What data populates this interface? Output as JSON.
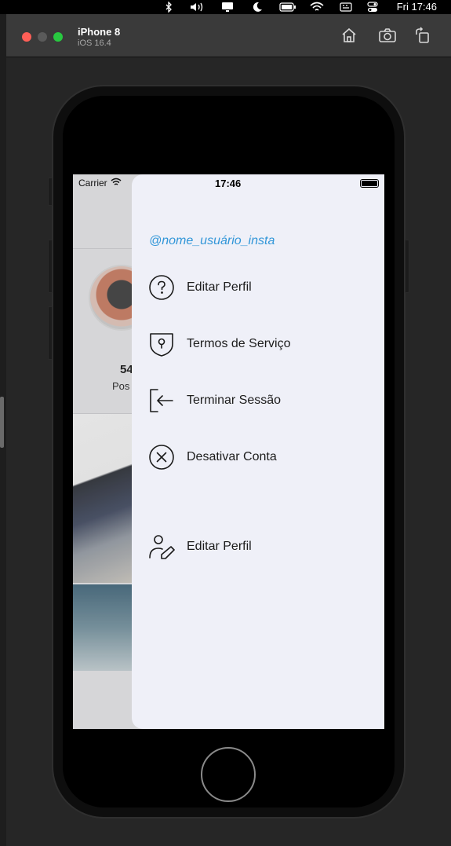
{
  "menubar": {
    "clock": "Fri 17:46",
    "icons": [
      "bluetooth-icon",
      "volume-icon",
      "display-icon",
      "moon-icon",
      "battery-icon",
      "wifi-icon",
      "keyboard-icon",
      "control-center-icon"
    ]
  },
  "simulator": {
    "device_name": "iPhone 8",
    "device_os": "iOS 16.4",
    "toolbar": [
      "home-icon",
      "screenshot-icon",
      "rotate-icon"
    ]
  },
  "ios_status": {
    "carrier": "Carrier",
    "time": "17:46"
  },
  "profile_background": {
    "post_count": "54",
    "post_label": "Pos"
  },
  "drawer": {
    "username": "@nome_usuário_insta",
    "items": [
      {
        "label": "Editar Perfil",
        "icon": "help-circle-icon"
      },
      {
        "label": "Termos de Serviço",
        "icon": "shield-icon"
      },
      {
        "label": "Terminar Sessão",
        "icon": "logout-icon"
      },
      {
        "label": "Desativar Conta",
        "icon": "close-circle-icon"
      },
      {
        "label": "Editar Perfil",
        "icon": "user-edit-icon"
      }
    ]
  },
  "colors": {
    "accent": "#3196d8",
    "drawer_bg": "#eff0f8",
    "close": "#fe5f57",
    "maximize": "#28c840"
  }
}
